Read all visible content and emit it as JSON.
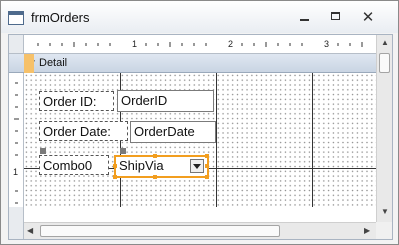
{
  "window": {
    "title": "frmOrders",
    "controls": {
      "minimize": "minimize",
      "maximize": "maximize",
      "close": "close"
    }
  },
  "ruler": {
    "horizontal_numbers": [
      "1",
      "2",
      "3"
    ],
    "vertical_numbers": [
      "1"
    ]
  },
  "section": {
    "label": "Detail"
  },
  "controls": {
    "order_id_label": "Order ID:",
    "order_id_textbox": "OrderID",
    "order_date_label": "Order Date:",
    "order_date_textbox": "OrderDate",
    "combo_label": "Combo0",
    "combo_value": "ShipVia"
  },
  "colors": {
    "selection": "#f29e1f",
    "section_bar": "#c9d5e3",
    "handle": "#7a7a7a"
  },
  "icons": {
    "window": "form-icon",
    "section": "section-collapse-icon",
    "combo_dropdown": "chevron-down-icon"
  }
}
